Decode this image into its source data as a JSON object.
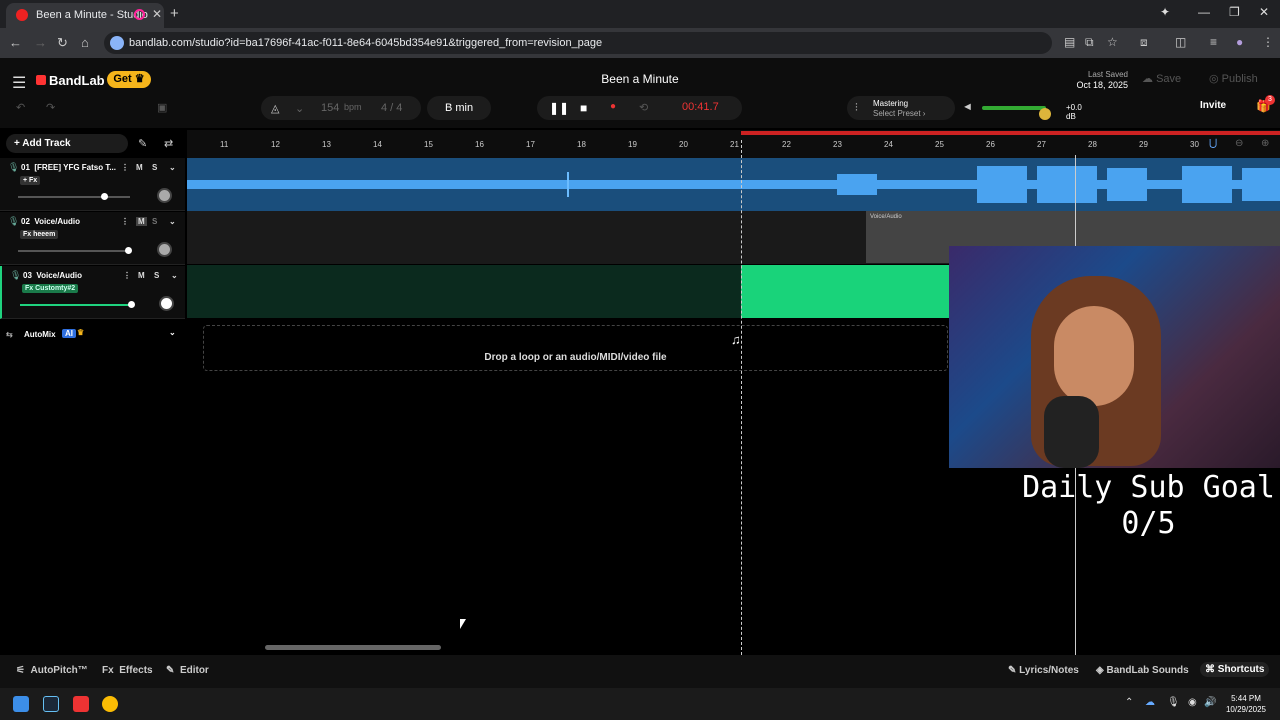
{
  "browser": {
    "tab_title": "Been a Minute - Studio",
    "url": "bandlab.com/studio?id=ba17696f-41ac-f011-8e64-6045bd354e91&triggered_from=revision_page"
  },
  "app": {
    "brand": "BandLab",
    "get_label": "Get",
    "song_title": "Been a Minute",
    "last_saved_label": "Last Saved",
    "last_saved_date": "Oct 18, 2025",
    "save_label": "Save",
    "publish_label": "Publish"
  },
  "transport": {
    "bpm": "154",
    "bpm_unit": "bpm",
    "time_sig": "4 / 4",
    "key": "B min",
    "time": "00:41.7",
    "mastering": "Mastering",
    "mastering_preset": "Select Preset",
    "volume_db": "+0.0 dB",
    "volume_level": 0.55
  },
  "header": {
    "invite_label": "Invite",
    "notif_count": "3"
  },
  "sidebar": {
    "add_track_label": "Add Track",
    "tracks": [
      {
        "number": "01",
        "name": "[FREE] YFG Fatso T...",
        "fx": "+ Fx",
        "mute": "M",
        "solo": "S",
        "volume": 0.76
      },
      {
        "number": "02",
        "name": "Voice/Audio",
        "fx": "Fx heeem",
        "mute": "M",
        "solo": "S",
        "volume": 0.98
      },
      {
        "number": "03",
        "name": "Voice/Audio",
        "fx": "Fx Customty#2",
        "mute": "M",
        "solo": "S",
        "volume": 1.0
      }
    ],
    "automix_label": "AutoMix",
    "ai_label": "AI"
  },
  "timeline": {
    "ticks": [
      "11",
      "12",
      "13",
      "14",
      "15",
      "16",
      "17",
      "18",
      "19",
      "20",
      "21",
      "22",
      "23",
      "24",
      "25",
      "26",
      "27",
      "28",
      "29",
      "30"
    ],
    "clip2_label": "Voice/Audio",
    "drop_text": "Drop a loop or an audio/MIDI/video file"
  },
  "overlay": {
    "goal_title": "Daily Sub Goal",
    "goal_count": "0/5"
  },
  "bottom": {
    "autopitch": "AutoPitch™",
    "effects": "Effects",
    "editor": "Editor",
    "lyrics": "Lyrics/Notes",
    "sounds": "BandLab Sounds",
    "shortcuts": "Shortcuts"
  },
  "taskbar": {
    "time": "5:44 PM",
    "date": "10/29/2025"
  }
}
